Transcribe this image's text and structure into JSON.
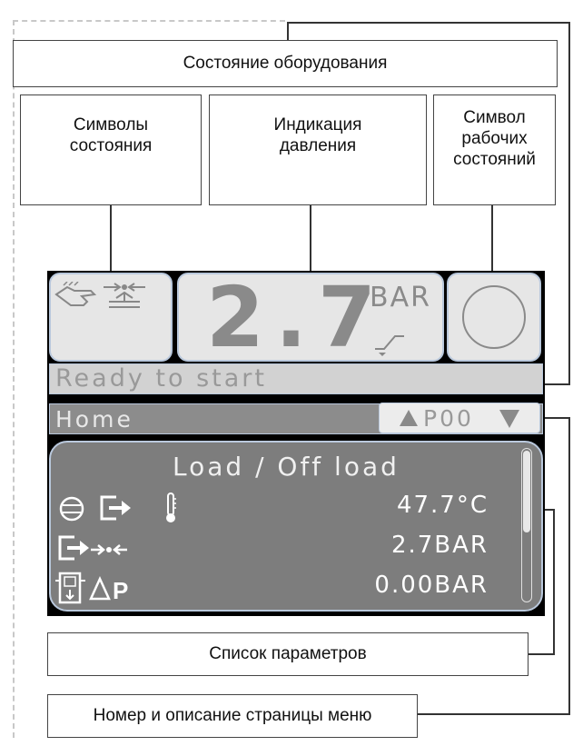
{
  "labels": {
    "equipment_state": "Состояние оборудования",
    "status_symbols": "Символы состояния",
    "pressure_indication": "Индикация давления",
    "operating_state_symbol": "Символ рабочих состояний",
    "parameter_list": "Список параметров",
    "menu_page": "Номер и описание страницы меню"
  },
  "display": {
    "pressure_value": "2.7",
    "pressure_unit": "BAR",
    "status_text": "Ready to start",
    "menu_title": "Home",
    "page_number": "P00",
    "parameters_title": "Load / Off load",
    "parameters": [
      {
        "value": "47.7°C",
        "icons": [
          "compressor-icon",
          "outlet-icon",
          "thermometer-icon"
        ]
      },
      {
        "value": "2.7BAR",
        "icons": [
          "outlet-icon",
          "pressure-sensor-icon"
        ]
      },
      {
        "value": "0.00BAR",
        "icons": [
          "filter-icon",
          "delta-p-icon"
        ]
      }
    ]
  },
  "colors": {
    "panel_fill": "#e6e6e6",
    "panel_border": "#b9c8dc",
    "parameter_panel": "#7d7d7d",
    "screen_bg": "#000000",
    "digit_gray": "#8a8a8a"
  }
}
